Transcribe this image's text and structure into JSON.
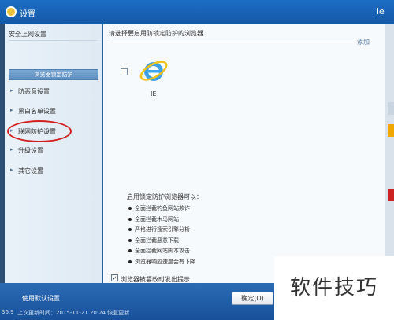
{
  "window": {
    "title": "设置",
    "right_text": "ie"
  },
  "sidebar": {
    "heading": "安全上网设置",
    "active_button": "浏览器锁定防护",
    "items": [
      {
        "label": "防恶意设置"
      },
      {
        "label": "黑白名单设置"
      },
      {
        "label": "联网防护设置"
      },
      {
        "label": "升级设置"
      },
      {
        "label": "其它设置"
      }
    ]
  },
  "content": {
    "title": "请选择要启用防锁定防护的浏览器",
    "add_link": "添加",
    "browsers": [
      {
        "label": "IE",
        "checked": false
      }
    ],
    "info_heading": "启用锁定防护浏览器可以：",
    "features": [
      "全面拦截钓鱼网站欺诈",
      "全面拦截木马网站",
      "严格进行搜索引擎分析",
      "全面拦截恶意下载",
      "全面拦截网站脚本攻击",
      "浏览器响应速度会有下降"
    ],
    "notify": {
      "label": "浏览器被篡改时发出提示",
      "checked": true
    }
  },
  "bottom": {
    "link": "使用默认设置",
    "status": "上次更新时间：2015-11-21 20:24    恢复更新",
    "left_num": "36.9",
    "confirm": "确定(O)"
  },
  "watermark": "软件技巧",
  "colors": {
    "title_bar": "#1d6ec6",
    "sidebar_bg": "#e9f1f8",
    "highlight_ring": "#d22020",
    "active_button": "#6b9bcb"
  }
}
